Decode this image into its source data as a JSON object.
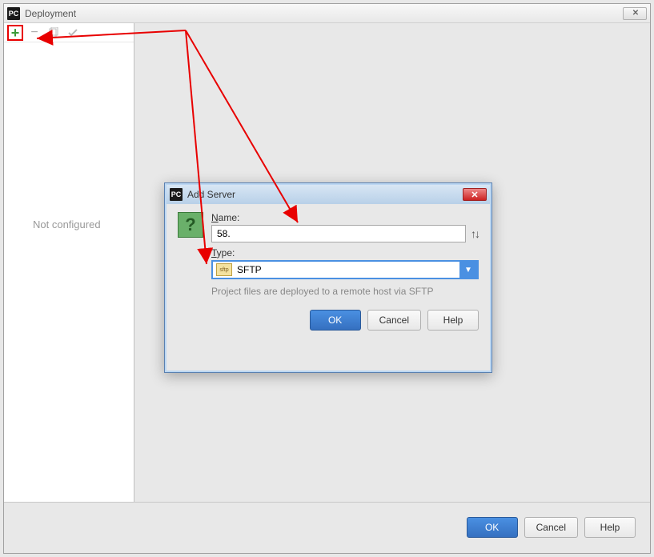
{
  "window": {
    "title": "Deployment",
    "app_icon_text": "PC"
  },
  "sidebar": {
    "not_configured": "Not configured"
  },
  "modal": {
    "title": "Add Server",
    "help_icon_text": "?",
    "name_label_prefix": "N",
    "name_label_rest": "ame:",
    "name_value": "58.",
    "type_label_prefix": "T",
    "type_label_rest": "ype:",
    "type_icon_text": "sftp",
    "type_value": "SFTP",
    "hint": "Project files are deployed to a remote host via SFTP",
    "buttons": {
      "ok": "OK",
      "cancel": "Cancel",
      "help": "Help"
    }
  },
  "footer": {
    "ok": "OK",
    "cancel": "Cancel",
    "help": "Help"
  }
}
